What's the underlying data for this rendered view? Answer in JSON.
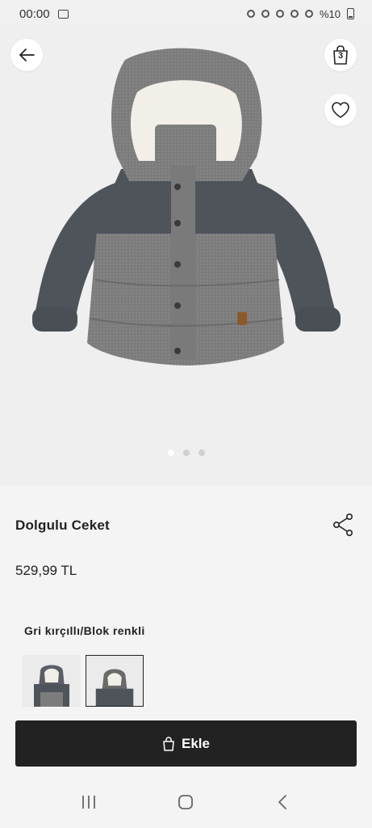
{
  "status": {
    "time": "00:00",
    "battery_text": "%10"
  },
  "header": {
    "bag_count": "3"
  },
  "gallery": {
    "image_count": 3,
    "active_index": 0
  },
  "product": {
    "name": "Dolgulu Ceket",
    "price": "529,99 TL",
    "color_label": "Gri kırçıllı/Blok renkli"
  },
  "actions": {
    "add_label": "Ekle"
  },
  "icons": {
    "back": "arrow-left-icon",
    "bag": "shopping-bag-icon",
    "favorite": "heart-icon",
    "share": "share-icon",
    "nav_recents": "recents-icon",
    "nav_home": "home-icon",
    "nav_back": "chevron-left-icon"
  },
  "colors": {
    "button_bg": "#222222",
    "page_bg": "#f4f4f4"
  }
}
